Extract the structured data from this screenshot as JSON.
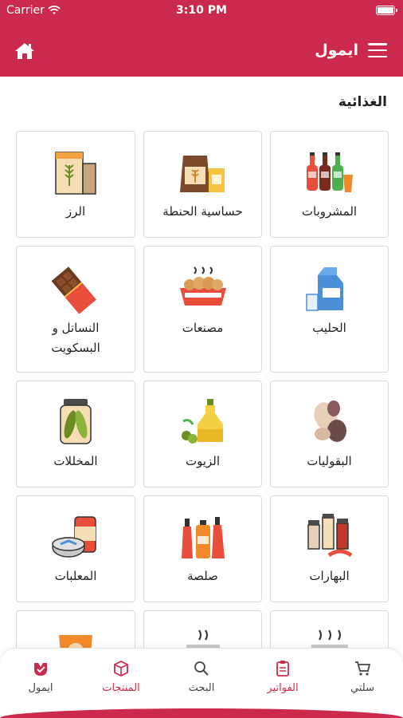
{
  "status_bar": {
    "carrier": "Carrier",
    "time": "3:10 PM"
  },
  "header": {
    "title": "ايمول"
  },
  "section_title": "الغذائية",
  "categories": [
    {
      "label": "المشروبات",
      "icon": "drinks-icon"
    },
    {
      "label": "حساسية الحنطة",
      "icon": "wheat-allergy-icon"
    },
    {
      "label": "الرز",
      "icon": "rice-icon"
    },
    {
      "label": "الحليب",
      "icon": "milk-icon"
    },
    {
      "label": "مصنعات",
      "icon": "processed-food-icon"
    },
    {
      "label": "النساتل و البسكويت",
      "icon": "chocolate-icon"
    },
    {
      "label": "البقوليات",
      "icon": "legumes-icon"
    },
    {
      "label": "الزيوت",
      "icon": "oil-icon"
    },
    {
      "label": "المخللات",
      "icon": "pickles-icon"
    },
    {
      "label": "البهارات",
      "icon": "spices-icon"
    },
    {
      "label": "صلصة",
      "icon": "sauce-icon"
    },
    {
      "label": "المعلبات",
      "icon": "canned-food-icon"
    },
    {
      "label": "",
      "icon": "hot-food-icon"
    },
    {
      "label": "",
      "icon": "hot-dish-icon"
    },
    {
      "label": "",
      "icon": "snack-bag-icon"
    }
  ],
  "bottom_nav": {
    "cart": "سلتي",
    "invoices": "الفواتير",
    "search": "البحث",
    "products": "المنتجات",
    "brand": "ايمول"
  },
  "colors": {
    "primary": "#cc2a4d"
  }
}
